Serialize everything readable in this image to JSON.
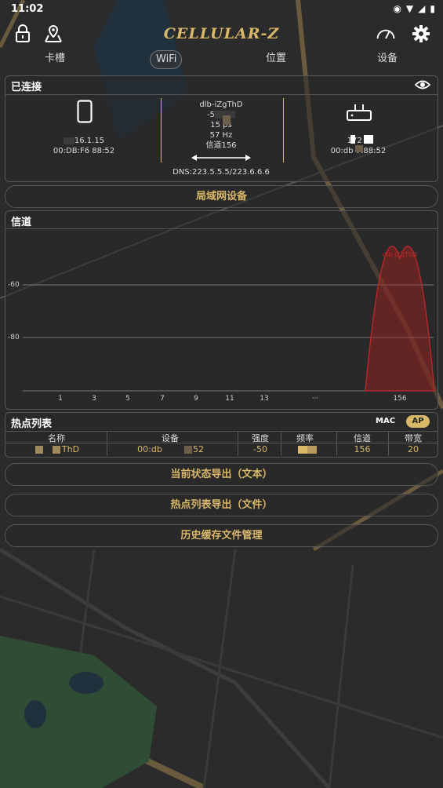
{
  "status_bar": {
    "time": "11:02",
    "battery": "▮"
  },
  "app": {
    "logo": "CELLULAR-Z"
  },
  "icons": {
    "lock": "lock-icon",
    "map_pin": "map-pin-icon",
    "speedometer": "speedometer-icon",
    "settings": "gear-icon",
    "eye": "eye-icon",
    "phone": "phone-icon",
    "router": "router-icon"
  },
  "tabs": [
    "卡槽",
    "WiFi",
    "位置",
    "设备"
  ],
  "active_tab": "WiFi",
  "connected": {
    "title": "已连接",
    "phone": {
      "ip": "16.1.15",
      "mac": "00:DB:F6  88:52"
    },
    "ap": {
      "ssid": "dlb-iZgThD",
      "rssi": "-5",
      "speed": "15  ps",
      "freq": "57  Hz",
      "channel": "信道156"
    },
    "router": {
      "ip": "172  2",
      "mac": "00:db  7:88:52"
    },
    "dns": "DNS:223.5.5.5/223.6.6.6"
  },
  "lan_button": "局域网设备",
  "channel_section": {
    "title": "信道",
    "peak_label": "dlb-iZgThD"
  },
  "chart_data": {
    "type": "area",
    "title": "信道",
    "x_tick_labels": [
      "1",
      "3",
      "5",
      "7",
      "9",
      "11",
      "13",
      "···",
      "156"
    ],
    "y_tick_labels": [
      "-60",
      "-80"
    ],
    "series": [
      {
        "name": "dlb-iZgThD",
        "channel": 156,
        "peak_dbm": -50
      }
    ],
    "grid": true
  },
  "hotspot": {
    "title": "热点列表",
    "mac_label": "MAC",
    "ap_label": "AP",
    "columns": [
      "名称",
      "设备",
      "强度",
      "频率",
      "信道",
      "带宽"
    ],
    "rows": [
      {
        "name": "ThD",
        "device_a": "00:db",
        "device_b": "52",
        "strength": "-50",
        "channel": "156",
        "bandwidth": "20"
      }
    ]
  },
  "actions": [
    "当前状态导出（文本）",
    "热点列表导出（文件）",
    "历史缓存文件管理"
  ],
  "colors": {
    "accent": "#d9b86a",
    "signal": "#c0282a",
    "background": "#2b2b2b"
  }
}
